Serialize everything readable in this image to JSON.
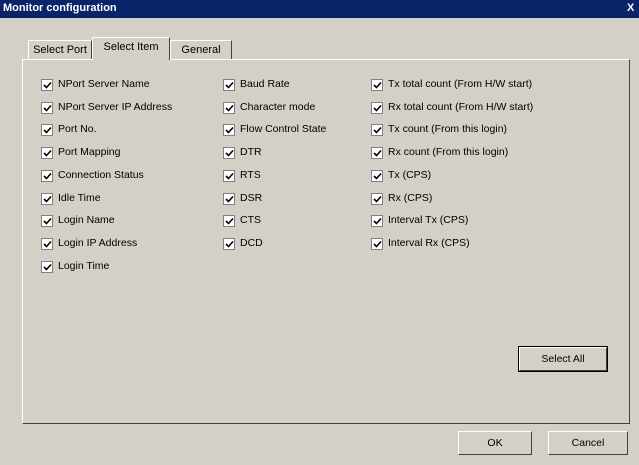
{
  "window": {
    "title": "Monitor configuration",
    "close_label": "X"
  },
  "tabs": [
    "Select Port",
    "Select Item",
    "General"
  ],
  "columns": [
    [
      "NPort Server Name",
      "NPort Server IP Address",
      "Port No.",
      "Port Mapping",
      "Connection Status",
      "Idle Time",
      "Login Name",
      "Login IP Address",
      "Login Time"
    ],
    [
      "Baud Rate",
      "Character mode",
      "Flow Control State",
      "DTR",
      "RTS",
      "DSR",
      "CTS",
      "DCD"
    ],
    [
      "Tx total count (From H/W start)",
      "Rx total count (From H/W start)",
      "Tx count (From this login)",
      "Rx count (From this login)",
      "Tx (CPS)",
      "Rx (CPS)",
      "Interval Tx (CPS)",
      "Interval Rx (CPS)"
    ]
  ],
  "checked": true,
  "buttons": {
    "select_all": "Select All",
    "ok": "OK",
    "cancel": "Cancel"
  }
}
